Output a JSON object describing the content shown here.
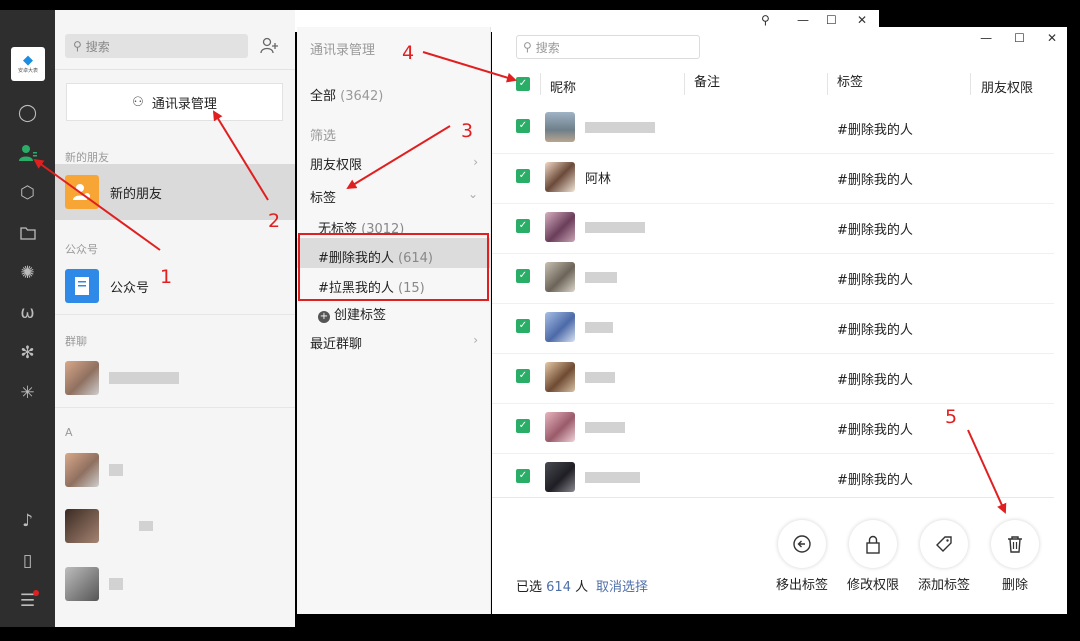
{
  "app_logo": {
    "text": "安卓大表"
  },
  "rail": {
    "icons": [
      "chat-icon",
      "contacts-icon",
      "cube-icon",
      "folder-icon",
      "aperture-icon",
      "channels-icon",
      "gear-icon",
      "spark-icon",
      "music-icon",
      "phone-icon",
      "menu-icon"
    ]
  },
  "contacts": {
    "search_placeholder": "搜索",
    "manage_button": "通讯录管理",
    "sections": {
      "new_friends": "新的朋友",
      "official": "公众号",
      "groups": "群聊",
      "letter_a": "A"
    },
    "items": {
      "new_friends": "新的朋友",
      "official": "公众号"
    }
  },
  "filters": {
    "title": "通讯录管理",
    "all_label": "全部",
    "all_count": "(3642)",
    "filter_section": "筛选",
    "friend_perm": "朋友权限",
    "tags": "标签",
    "tag_list": [
      {
        "label": "无标签",
        "count": "(3012)"
      },
      {
        "label": "#删除我的人",
        "count": "(614)"
      },
      {
        "label": "#拉黑我的人",
        "count": "(15)"
      }
    ],
    "create_tag": "创建标签",
    "recent_groups": "最近群聊"
  },
  "main": {
    "search_placeholder": "搜索",
    "columns": {
      "nickname": "昵称",
      "remark": "备注",
      "tag": "标签",
      "perm": "朋友权限"
    },
    "rows": [
      {
        "name": "",
        "tag": "#删除我的人"
      },
      {
        "name": "阿林",
        "tag": "#删除我的人"
      },
      {
        "name": "",
        "tag": "#删除我的人"
      },
      {
        "name": "",
        "tag": "#删除我的人"
      },
      {
        "name": "",
        "tag": "#删除我的人"
      },
      {
        "name": "",
        "tag": "#删除我的人"
      },
      {
        "name": "",
        "tag": "#删除我的人"
      },
      {
        "name": "",
        "tag": "#删除我的人"
      }
    ],
    "selected_prefix": "已选",
    "selected_count": "614",
    "selected_suffix": "人",
    "cancel_selection": "取消选择",
    "actions": {
      "remove_tag": "移出标签",
      "edit_perm": "修改权限",
      "add_tag": "添加标签",
      "delete": "删除"
    }
  },
  "annotations": {
    "n1": "1",
    "n2": "2",
    "n3": "3",
    "n4": "4",
    "n5": "5"
  },
  "colors": {
    "check_green": "#2aae67",
    "annotation_red": "#e02020",
    "link_blue": "#4f6fa8",
    "rail_dark": "#2e2e2e"
  }
}
